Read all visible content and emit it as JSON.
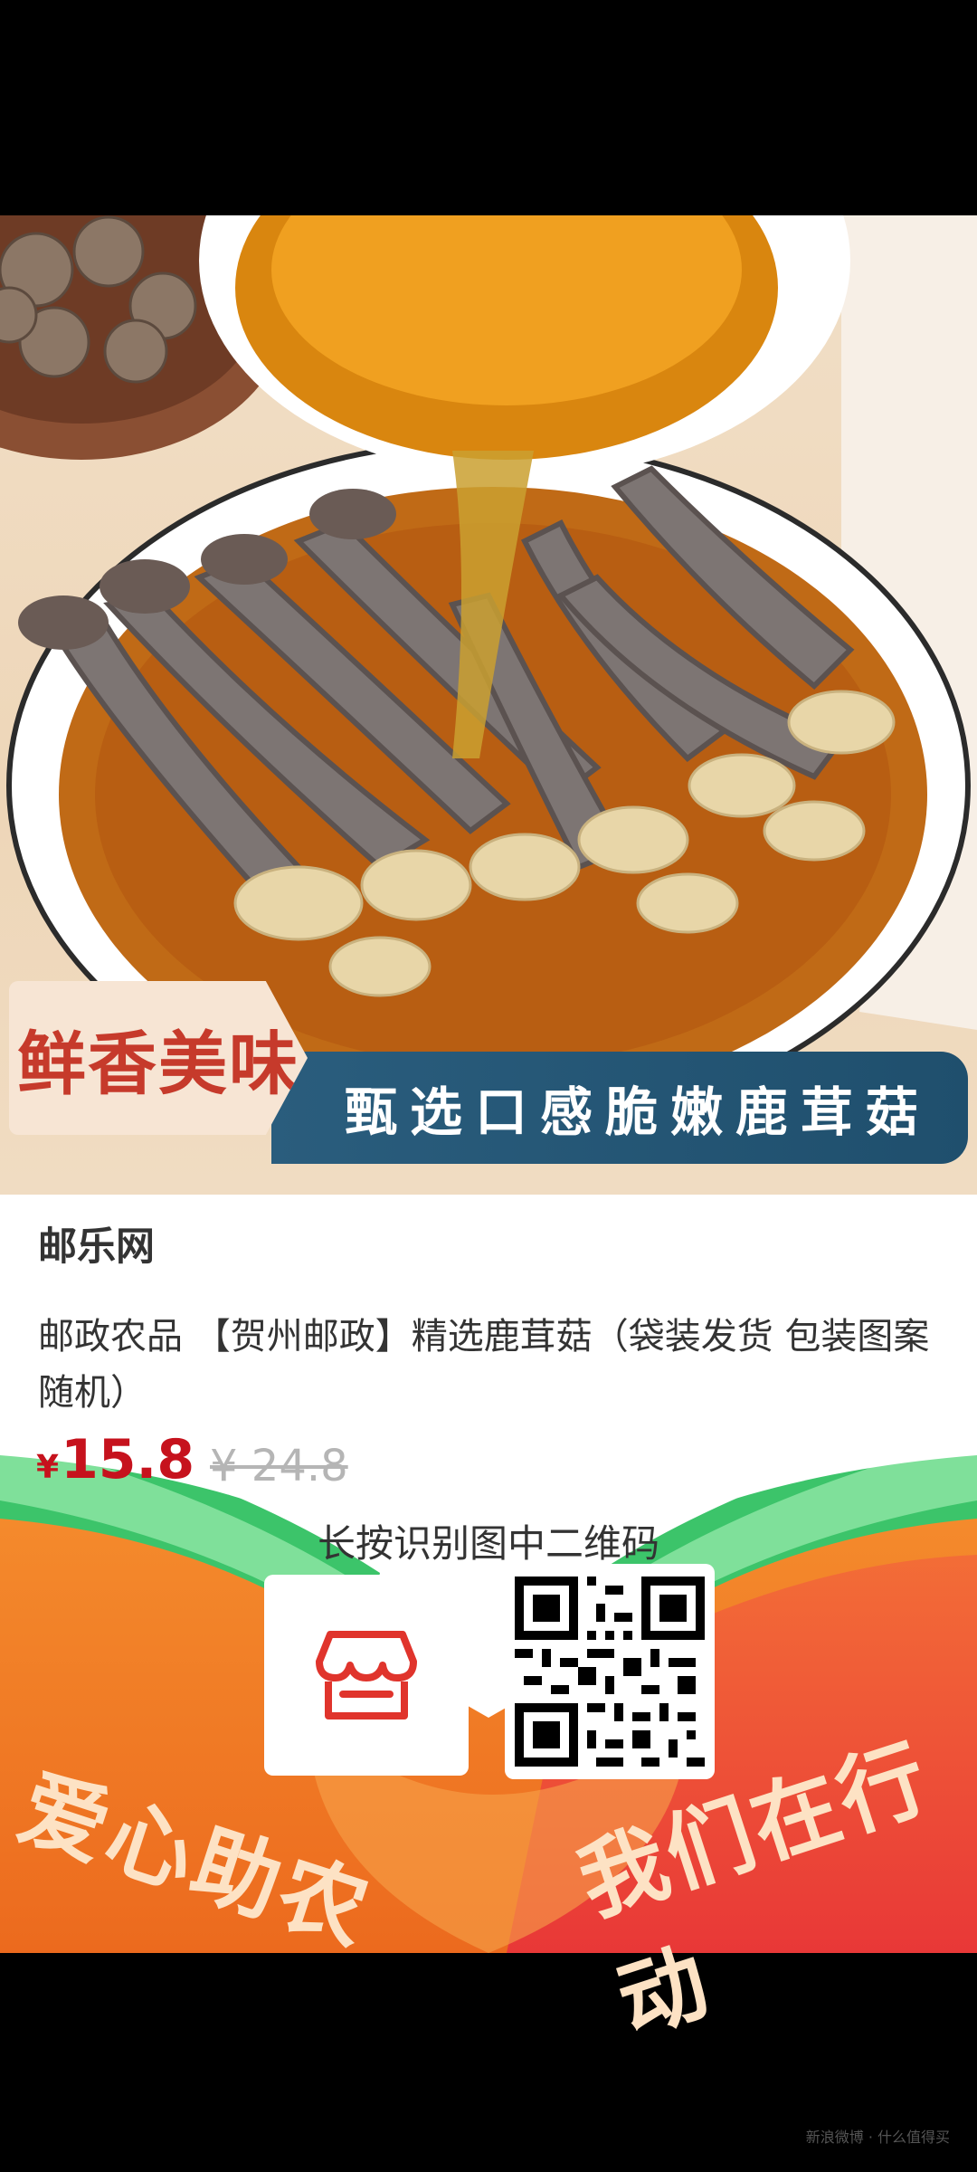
{
  "photo": {
    "tag": "鲜香美味",
    "banner": "甄选口感脆嫩鹿茸菇"
  },
  "product": {
    "seller": "邮乐网",
    "title": "邮政农品 【贺州邮政】精选鹿茸菇（袋装发货 包装图案随机）",
    "currency": "¥",
    "price": "15.8",
    "original_price": "¥ 24.8"
  },
  "poster": {
    "qr_hint": "长按识别图中二维码",
    "slogan_left": "爱心助农",
    "slogan_right": "我们在行动"
  },
  "watermark": "新浪微博 · 什么值得买",
  "colors": {
    "price_red": "#c6121d",
    "banner_blue": "#245775",
    "poster_orange": "#f07a2a",
    "poster_green": "#3cc46a"
  },
  "icons": {
    "shop": "store-icon",
    "qr": "qr-code-icon"
  }
}
